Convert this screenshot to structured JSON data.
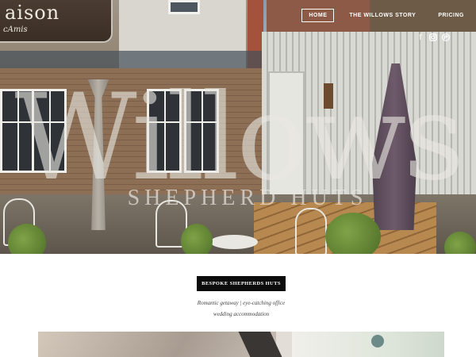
{
  "nav": {
    "items": [
      {
        "label": "HOME",
        "active": true
      },
      {
        "label": "THE WILLOWS STORY",
        "active": false
      },
      {
        "label": "PRICING",
        "active": false
      }
    ]
  },
  "social": {
    "icons": [
      "facebook-icon",
      "instagram-icon",
      "pinterest-icon"
    ]
  },
  "hero": {
    "logo_main": "Willows",
    "logo_sub": "SHEPHERD HUTS",
    "sign_line1": "aison",
    "sign_line2": "cAmis"
  },
  "cta": {
    "label": "BESPOKE SHEPHERDS HUTS"
  },
  "tagline": {
    "line1": "Romantic getaway  |  eye-catching office",
    "line2": "wedding accommodation"
  },
  "colors": {
    "cta_bg": "#0c0c0c",
    "nav_text": "#ffffff",
    "page_bg": "#ffffff"
  }
}
